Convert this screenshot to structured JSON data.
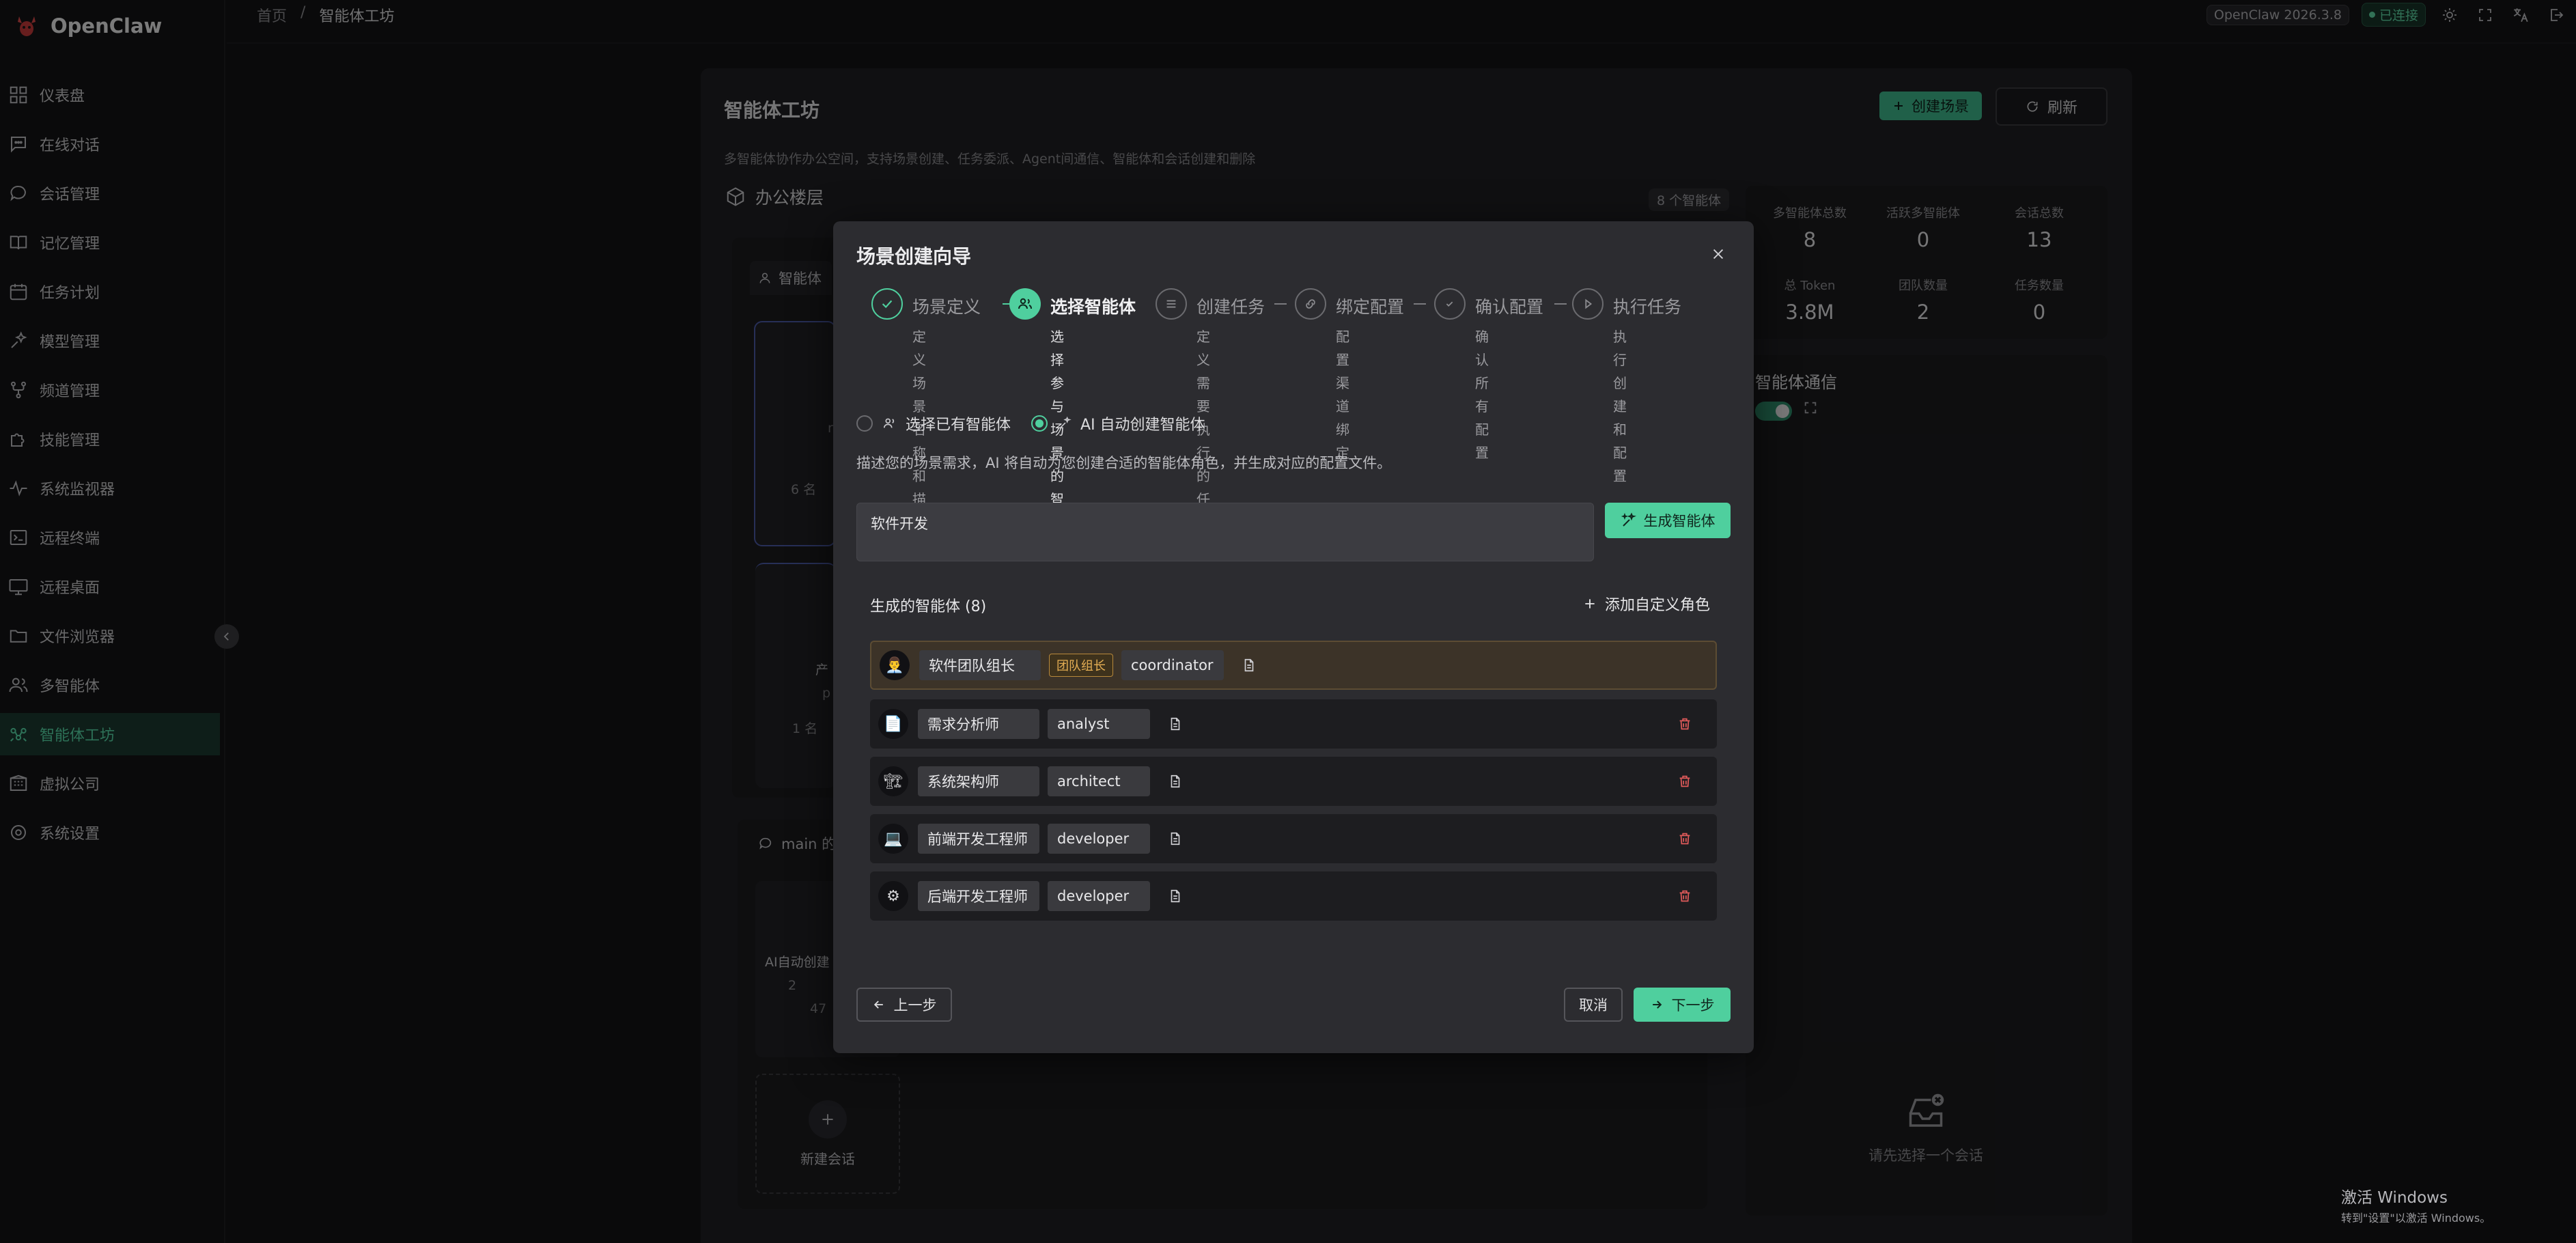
{
  "app": {
    "name": "OpenClaw"
  },
  "sidebar": {
    "items": [
      {
        "label": "仪表盘",
        "icon": "dashboard-icon"
      },
      {
        "label": "在线对话",
        "icon": "chat-icon"
      },
      {
        "label": "会话管理",
        "icon": "session-icon"
      },
      {
        "label": "记忆管理",
        "icon": "book-icon"
      },
      {
        "label": "任务计划",
        "icon": "calendar-icon"
      },
      {
        "label": "模型管理",
        "icon": "model-icon"
      },
      {
        "label": "频道管理",
        "icon": "channel-icon"
      },
      {
        "label": "技能管理",
        "icon": "puzzle-icon"
      },
      {
        "label": "系统监视器",
        "icon": "pulse-icon"
      },
      {
        "label": "远程终端",
        "icon": "terminal-icon"
      },
      {
        "label": "远程桌面",
        "icon": "monitor-icon"
      },
      {
        "label": "文件浏览器",
        "icon": "folder-icon"
      },
      {
        "label": "多智能体",
        "icon": "users-icon"
      },
      {
        "label": "智能体工坊",
        "icon": "workshop-icon",
        "active": true
      },
      {
        "label": "虚拟公司",
        "icon": "building-icon"
      },
      {
        "label": "系统设置",
        "icon": "gear-icon"
      }
    ]
  },
  "topbar": {
    "breadcrumb": [
      "首页",
      "智能体工坊"
    ],
    "version": "OpenClaw 2026.3.8",
    "status": "已连接"
  },
  "workshop": {
    "title": "智能体工坊",
    "subtitle": "多智能体协作办公空间，支持场景创建、任务委派、Agent间通信、智能体和会话创建和删除",
    "create_scene": "创建场景",
    "refresh": "刷新",
    "office_title": "办公楼层",
    "agent_count": "8 个智能体",
    "agent_tab": "智能体",
    "frag_r": "r",
    "frag_6": "6 名",
    "frag_chan": "产",
    "frag_p": "p",
    "frag_1": "1 名",
    "main_title": "main 的",
    "session_name": "AI自动创建",
    "session_meta1": "2",
    "session_meta2": "47",
    "new_session": "新建会话"
  },
  "stats": [
    {
      "label": "多智能体总数",
      "value": "8"
    },
    {
      "label": "活跃多智能体",
      "value": "0"
    },
    {
      "label": "会话总数",
      "value": "13"
    },
    {
      "label": "总 Token",
      "value": "3.8M"
    },
    {
      "label": "团队数量",
      "value": "2"
    },
    {
      "label": "任务数量",
      "value": "0"
    }
  ],
  "comm": {
    "title": "智能体通信",
    "empty": "请先选择一个会话"
  },
  "watermark": {
    "line1": "激活 Windows",
    "line2": "转到\"设置\"以激活 Windows。"
  },
  "wizard": {
    "title": "场景创建向导",
    "steps": [
      {
        "title": "场景定义",
        "desc1": "定义场景名称和",
        "desc2": "描述",
        "state": "done"
      },
      {
        "title": "选择智能体",
        "desc1": "选择参与场景的",
        "desc2": "智能体",
        "state": "active"
      },
      {
        "title": "创建任务",
        "desc1": "定义需要执行的",
        "desc2": "任务",
        "state": "pending"
      },
      {
        "title": "绑定配置",
        "desc1": "配置渠道绑定",
        "desc2": "",
        "state": "pending"
      },
      {
        "title": "确认配置",
        "desc1": "确认所有配置",
        "desc2": "",
        "state": "pending"
      },
      {
        "title": "执行任务",
        "desc1": "执行创建和配置",
        "desc2": "",
        "state": "pending"
      }
    ],
    "mode_existing": "选择已有智能体",
    "mode_ai": "AI 自动创建智能体",
    "mode_desc": "描述您的场景需求，AI 将自动为您创建合适的智能体角色，并生成对应的配置文件。",
    "scene_value": "软件开发",
    "generate_btn": "生成智能体",
    "generated_header": "生成的智能体 (8)",
    "add_custom": "添加自定义角色",
    "agents": [
      {
        "avatar": "👨‍💼",
        "name": "软件团队组长",
        "tag": "团队组长",
        "role": "coordinator"
      },
      {
        "avatar": "📄",
        "name": "需求分析师",
        "role": "analyst"
      },
      {
        "avatar": "🏗",
        "name": "系统架构师",
        "role": "architect"
      },
      {
        "avatar": "💻",
        "name": "前端开发工程师",
        "role": "developer"
      },
      {
        "avatar": "⚙",
        "name": "后端开发工程师",
        "role": "developer"
      }
    ],
    "prev": "上一步",
    "cancel": "取消",
    "next": "下一步"
  }
}
